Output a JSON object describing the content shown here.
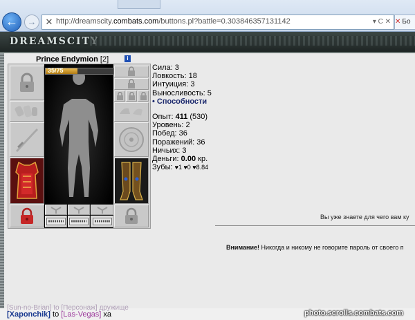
{
  "browser": {
    "url_prefix": "http://dreamscity.",
    "url_domain": "combats.com",
    "url_path": "/buttons.pl?battle=0.303846357131142",
    "tab_label": "Бо",
    "controls": "▾ C ✕"
  },
  "game": {
    "logo": "DREAMSCITY",
    "character": {
      "name": "Prince Endymion",
      "level": "[2]",
      "info_icon": "i"
    },
    "hp": {
      "text": "35/75",
      "fraction": 0.47
    },
    "stats": [
      {
        "label": "Сила:",
        "value": "3"
      },
      {
        "label": "Ловкость:",
        "value": "18"
      },
      {
        "label": "Интуиция:",
        "value": "3"
      },
      {
        "label": "Выносливость:",
        "value": "5"
      }
    ],
    "abilities_link": "• Способности",
    "experience": {
      "label": "Опыт:",
      "value": "411",
      "next": "(530)"
    },
    "level": {
      "label": "Уровень:",
      "value": "2"
    },
    "wins": {
      "label": "Побед:",
      "value": "36"
    },
    "losses": {
      "label": "Поражений:",
      "value": "36"
    },
    "draws": {
      "label": "Ничьих:",
      "value": "3"
    },
    "money": {
      "label": "Деньги:",
      "value": "0.00",
      "unit": "кр."
    },
    "teeth": {
      "label": "Зубы:",
      "value": "♥1 ♥0 ♥8.84"
    },
    "right_message": "Вы уже знаете для чего вам ку",
    "warning": {
      "bold": "Внимание!",
      "text": " Никогда и никому не говорите пароль от своего п"
    }
  },
  "chat": {
    "faded_line": "[Sun-no-Brian] to [Персонаж] дружище",
    "line": {
      "nick": "[Xaponchik]",
      "to": " to ",
      "target": "[Las-Vegas]",
      "tail": " xa"
    }
  },
  "watermark": "photo.scrolls.combats.com",
  "colors": {
    "accent": "#1d2a6e",
    "hp_fill": "#e8b84c",
    "banner": "#2c3433"
  }
}
